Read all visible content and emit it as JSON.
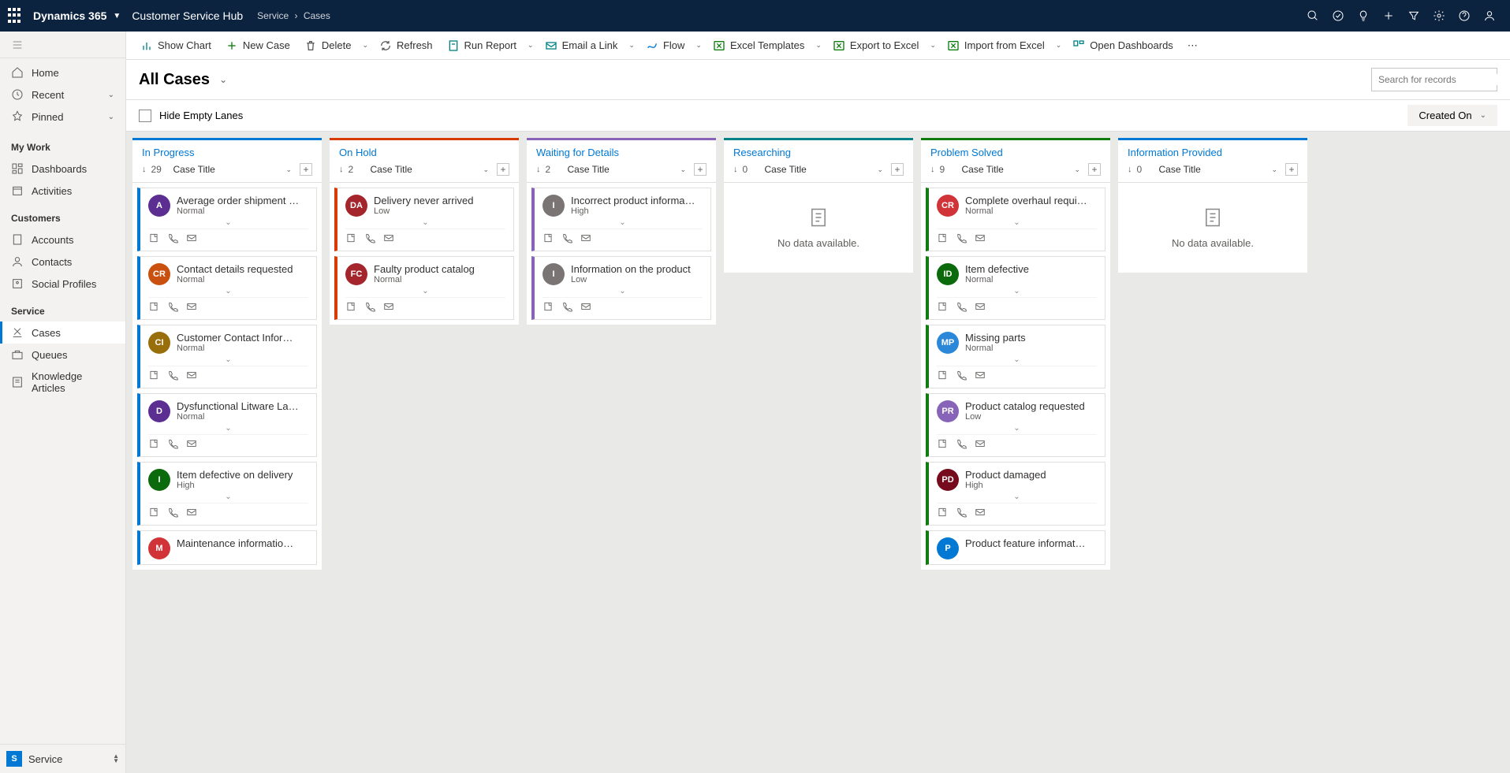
{
  "topbar": {
    "brand": "Dynamics 365",
    "hub": "Customer Service Hub",
    "breadcrumb": [
      "Service",
      "Cases"
    ]
  },
  "sidebar": {
    "top": [
      {
        "icon": "home",
        "label": "Home"
      },
      {
        "icon": "clock",
        "label": "Recent",
        "expandable": true
      },
      {
        "icon": "pin",
        "label": "Pinned",
        "expandable": true
      }
    ],
    "groups": [
      {
        "title": "My Work",
        "items": [
          {
            "icon": "dash",
            "label": "Dashboards"
          },
          {
            "icon": "activity",
            "label": "Activities"
          }
        ]
      },
      {
        "title": "Customers",
        "items": [
          {
            "icon": "building",
            "label": "Accounts"
          },
          {
            "icon": "person",
            "label": "Contacts"
          },
          {
            "icon": "social",
            "label": "Social Profiles"
          }
        ]
      },
      {
        "title": "Service",
        "items": [
          {
            "icon": "case",
            "label": "Cases",
            "active": true
          },
          {
            "icon": "queue",
            "label": "Queues"
          },
          {
            "icon": "kb",
            "label": "Knowledge Articles"
          }
        ]
      }
    ],
    "footer": {
      "badge": "S",
      "label": "Service"
    }
  },
  "commands": [
    {
      "icon": "chart",
      "label": "Show Chart",
      "color": "#038387"
    },
    {
      "icon": "plus",
      "label": "New Case",
      "color": "#107c10"
    },
    {
      "icon": "trash",
      "label": "Delete",
      "color": "#605e5c",
      "split": true
    },
    {
      "icon": "refresh",
      "label": "Refresh",
      "color": "#605e5c"
    },
    {
      "icon": "report",
      "label": "Run Report",
      "color": "#038387",
      "split": true
    },
    {
      "icon": "link",
      "label": "Email a Link",
      "color": "#038387",
      "split": true
    },
    {
      "icon": "flow",
      "label": "Flow",
      "color": "#0078d4",
      "split": true
    },
    {
      "icon": "excel",
      "label": "Excel Templates",
      "color": "#107c10",
      "split": true
    },
    {
      "icon": "excel",
      "label": "Export to Excel",
      "color": "#107c10",
      "split": true
    },
    {
      "icon": "excel",
      "label": "Import from Excel",
      "color": "#107c10",
      "split": true
    },
    {
      "icon": "dash",
      "label": "Open Dashboards",
      "color": "#038387"
    }
  ],
  "view": {
    "title": "All Cases",
    "search_placeholder": "Search for records",
    "hide_empty": "Hide Empty Lanes",
    "sort_label": "Created On",
    "case_title_label": "Case Title",
    "no_data": "No data available."
  },
  "lanes": [
    {
      "name": "In Progress",
      "color": "#0078d4",
      "count": 29,
      "cards": [
        {
          "avatar": "A",
          "bg": "#5c2e91",
          "title": "Average order shipment …",
          "priority": "Normal"
        },
        {
          "avatar": "CR",
          "bg": "#ca5010",
          "title": "Contact details requested",
          "priority": "Normal"
        },
        {
          "avatar": "CI",
          "bg": "#986f0b",
          "title": "Customer Contact Infor…",
          "priority": "Normal"
        },
        {
          "avatar": "D",
          "bg": "#5c2e91",
          "title": "Dysfunctional Litware La…",
          "priority": "Normal"
        },
        {
          "avatar": "I",
          "bg": "#0b6a0b",
          "title": "Item defective on delivery",
          "priority": "High"
        },
        {
          "avatar": "M",
          "bg": "#d13438",
          "title": "Maintenance informatio…",
          "priority": ""
        }
      ]
    },
    {
      "name": "On Hold",
      "color": "#d83b01",
      "count": 2,
      "cards": [
        {
          "avatar": "DA",
          "bg": "#a4262c",
          "title": "Delivery never arrived",
          "priority": "Low"
        },
        {
          "avatar": "FC",
          "bg": "#a4262c",
          "title": "Faulty product catalog",
          "priority": "Normal"
        }
      ]
    },
    {
      "name": "Waiting for Details",
      "color": "#8764b8",
      "count": 2,
      "cards": [
        {
          "avatar": "I",
          "bg": "#7a7574",
          "title": "Incorrect product informa…",
          "priority": "High"
        },
        {
          "avatar": "I",
          "bg": "#7a7574",
          "title": "Information on the product",
          "priority": "Low"
        }
      ]
    },
    {
      "name": "Researching",
      "color": "#038387",
      "count": 0,
      "cards": []
    },
    {
      "name": "Problem Solved",
      "color": "#107c10",
      "count": 9,
      "cards": [
        {
          "avatar": "CR",
          "bg": "#d13438",
          "title": "Complete overhaul requi…",
          "priority": "Normal"
        },
        {
          "avatar": "ID",
          "bg": "#0b6a0b",
          "title": "Item defective",
          "priority": "Normal"
        },
        {
          "avatar": "MP",
          "bg": "#2b88d8",
          "title": "Missing parts",
          "priority": "Normal"
        },
        {
          "avatar": "PR",
          "bg": "#8764b8",
          "title": "Product catalog requested",
          "priority": "Low"
        },
        {
          "avatar": "PD",
          "bg": "#750b1c",
          "title": "Product damaged",
          "priority": "High"
        },
        {
          "avatar": "P",
          "bg": "#0078d4",
          "title": "Product feature informat…",
          "priority": ""
        }
      ]
    },
    {
      "name": "Information Provided",
      "color": "#0078d4",
      "count": 0,
      "cards": []
    }
  ]
}
